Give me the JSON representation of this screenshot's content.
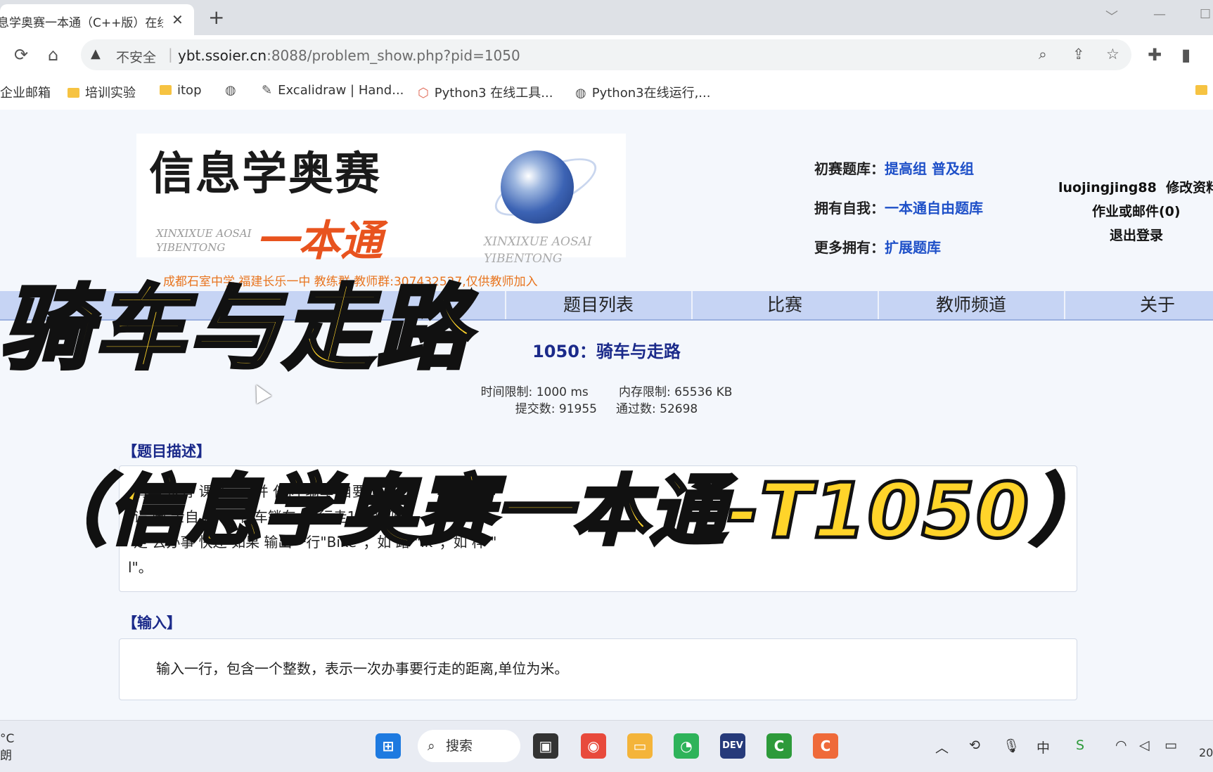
{
  "browser": {
    "tab_title": "息学奥赛一本通（C++版）在线",
    "tab_close": "✕",
    "new_tab": "+",
    "insecure_label": "不安全",
    "url_host": "ybt.ssoier.cn",
    "url_rest": ":8088/problem_show.php?pid=1050",
    "bookmarks": [
      {
        "label": "企业邮箱",
        "icon": "none"
      },
      {
        "label": "培训实验",
        "icon": "folder-icon"
      },
      {
        "label": "itop",
        "icon": "folder-icon"
      },
      {
        "label": "",
        "icon": "globe-icon"
      },
      {
        "label": "Excalidraw | Hand...",
        "icon": "pen-icon"
      },
      {
        "label": "Python3 在线工具...",
        "icon": "cube-icon"
      },
      {
        "label": "Python3在线运行,...",
        "icon": "globe-icon"
      }
    ]
  },
  "header": {
    "logo_title": "信息学奥赛",
    "logo_sub": "一本通",
    "logo_pinyin_a": "XINXIXUE AOSAI",
    "logo_pinyin_b": "YIBENTONG",
    "notice": "成都石室中学 福建长乐一中 教练群 教师群:307432527,仅供教师加入",
    "links": [
      {
        "label": "初赛题库：",
        "items": "提高组 普及组"
      },
      {
        "label": "拥有自我：",
        "items": "一本通自由题库"
      },
      {
        "label": "更多拥有：",
        "items": "扩展题库"
      }
    ],
    "user": {
      "name": "luojingjing88",
      "edit": "修改资料",
      "mail": "作业或邮件(0)",
      "logout": "退出登录"
    }
  },
  "nav": [
    "题目列表",
    "比赛",
    "教师频道",
    "关于"
  ],
  "problem": {
    "title": "1050：骑车与走路",
    "limits_line1": "时间限制: 1000 ms        内存限制: 65536 KB",
    "limits_line2": "提交数: 91955     通过数: 52698",
    "desc_head": "【题目描述】",
    "desc_text_1": "清华       没有       课       方       。      并       任何       骑车        自要步",
    "desc_text_2": "误         闲       士自        27秒       停车锁车       秒       行走1.2米       骑",
    "desc_text_3": "走         去办事       快还       如果       输出一行\"Bike\"；如         路       \"lk\"；如       样       \"",
    "desc_text_4": "l\"。",
    "input_head": "【输入】",
    "input_text": "输入一行，包含一个整数，表示一次办事要行走的距离,单位为米。"
  },
  "overlay": {
    "title": "骑车与走路",
    "subtitle": "（信息学奥赛一本通-T1050）"
  },
  "taskbar": {
    "weather_temp": "°C",
    "weather_desc": "朗",
    "search_label": "搜索",
    "clock": "20"
  }
}
